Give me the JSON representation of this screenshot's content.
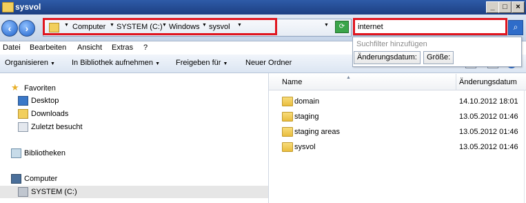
{
  "window": {
    "title": "sysvol"
  },
  "address": {
    "crumbs": [
      "Computer",
      "SYSTEM (C:)",
      "Windows",
      "sysvol"
    ]
  },
  "search": {
    "value": "internet",
    "suggest_hint": "Suchfilter hinzufügen",
    "filters": [
      "Änderungsdatum:",
      "Größe:"
    ]
  },
  "menu": [
    "Datei",
    "Bearbeiten",
    "Ansicht",
    "Extras",
    "?"
  ],
  "toolbar": [
    "Organisieren",
    "In Bibliothek aufnehmen",
    "Freigeben für",
    "Neuer Ordner"
  ],
  "nav": {
    "favorites": "Favoriten",
    "desktop": "Desktop",
    "downloads": "Downloads",
    "recent": "Zuletzt besucht",
    "libraries": "Bibliotheken",
    "computer": "Computer",
    "system_drive": "SYSTEM (C:)"
  },
  "columns": {
    "name": "Name",
    "modified": "Änderungsdatum"
  },
  "files": [
    {
      "name": "domain",
      "modified": "14.10.2012 18:01"
    },
    {
      "name": "staging",
      "modified": "13.05.2012 01:46"
    },
    {
      "name": "staging areas",
      "modified": "13.05.2012 01:46"
    },
    {
      "name": "sysvol",
      "modified": "13.05.2012 01:46"
    }
  ],
  "colors": {
    "highlight": "#e0151f",
    "titlebar": "#2e5ba8"
  }
}
